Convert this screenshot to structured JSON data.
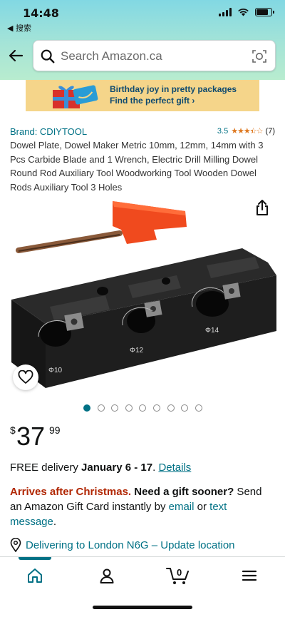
{
  "status_bar": {
    "time": "14:48",
    "back_app": "◀ 搜索"
  },
  "search": {
    "placeholder": "Search Amazon.ca"
  },
  "banner": {
    "line1": "Birthday joy in pretty packages",
    "line2": "Find the perfect gift ›"
  },
  "product": {
    "brand": "Brand: CDIYTOOL",
    "rating": "3.5",
    "rating_count": "(7)",
    "title": "Dowel Plate, Dowel Maker Metric 10mm, 12mm, 14mm with 3 Pcs Carbide Blade and 1 Wrench, Electric Drill Milling Dowel Round Rod Auxiliary Tool Woodworking Tool Wooden Dowel Rods Auxiliary Tool 3 Holes",
    "hole_labels": [
      "Φ10",
      "Φ12",
      "Φ14"
    ],
    "image_count": 9,
    "active_image": 1
  },
  "price": {
    "symbol": "$",
    "whole": "37",
    "fraction": "99"
  },
  "delivery": {
    "prefix": "FREE delivery ",
    "dates": "January 6 - 17",
    "sep": ". ",
    "details_link": "Details"
  },
  "gift_notice": {
    "warning": "Arrives after Christmas.",
    "question": " Need a gift sooner?",
    "text1": " Send an Amazon Gift Card instantly by ",
    "email_link": "email",
    "text2": " or ",
    "text_link": "text message",
    "end": "."
  },
  "location": {
    "text": "Delivering to London N6G – Update location"
  },
  "nav": {
    "cart_count": "0"
  },
  "colors": {
    "accent": "#007185",
    "price_warning": "#b12704",
    "star": "#de7921"
  }
}
